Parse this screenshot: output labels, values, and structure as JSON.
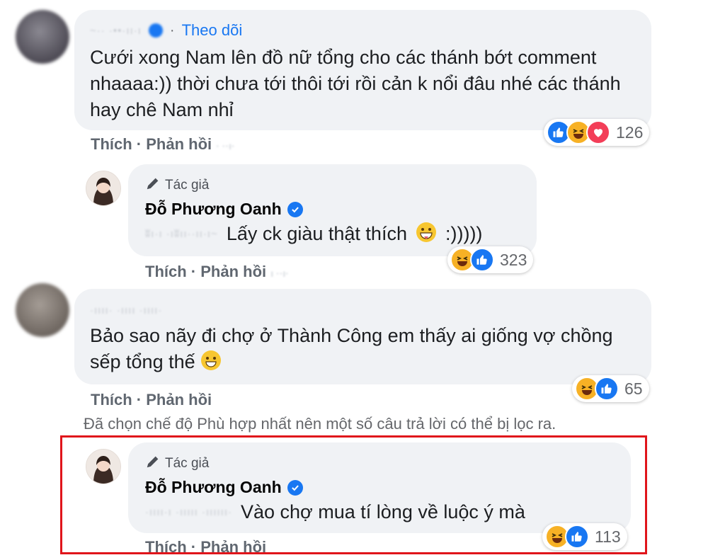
{
  "comments": [
    {
      "follow_label": "Theo dõi",
      "text": "Cưới xong Nam lên đồ nữ tổng cho các thánh bớt comment nhaaaa:)) thời chưa tới thôi tới rồi cản k nổi đâu nhé các thánh hay chê Nam nhỉ",
      "reaction_count": "126",
      "like_label": "Thích",
      "reply_label": "Phản hồi"
    },
    {
      "author_badge": "Tác giả",
      "author_name": "Đỗ Phương Oanh",
      "text": "Lấy ck giàu thật thích",
      "text_suffix": ":)))))",
      "reaction_count": "323",
      "like_label": "Thích",
      "reply_label": "Phản hồi"
    },
    {
      "text": "Bảo sao nãy đi chợ ở Thành Công em thấy ai giống vợ chồng sếp tổng thế",
      "reaction_count": "65",
      "like_label": "Thích",
      "reply_label": "Phản hồi"
    },
    {
      "author_badge": "Tác giả",
      "author_name": "Đỗ Phương Oanh",
      "text": "Vào chợ mua tí lòng về luộc ý mà",
      "reaction_count": "113",
      "like_label": "Thích",
      "reply_label": "Phản hồi"
    }
  ],
  "filter_note": "Đã chọn chế độ Phù hợp nhất nên một số câu trả lời có thể bị lọc ra.",
  "colors": {
    "highlight_border": "#e0151b",
    "link_blue": "#1877f2",
    "bubble": "#f0f2f5"
  }
}
